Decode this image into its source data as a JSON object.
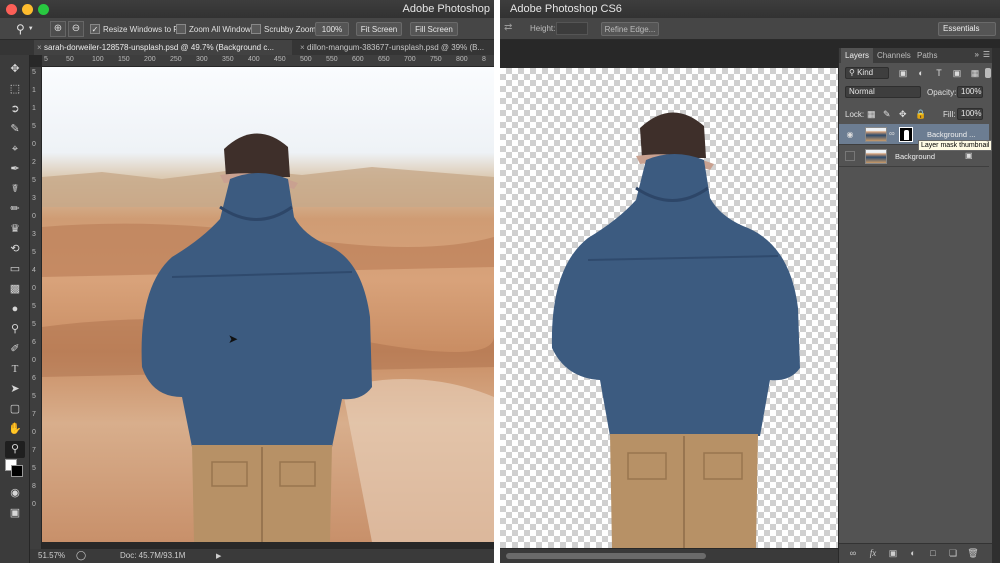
{
  "left": {
    "title": "Adobe Photoshop",
    "options": {
      "resize_windows": "Resize Windows to Fit",
      "zoom_all": "Zoom All Windows",
      "scrubby": "Scrubby Zoom",
      "zoom_value": "100%",
      "fit_screen": "Fit Screen",
      "fill_screen": "Fill Screen"
    },
    "tabs": [
      {
        "label": "sarah-dorweiler-128578-unsplash.psd @ 49.7% (Background c..."
      },
      {
        "label": "dillon-mangum-383677-unsplash.psd @ 39% (B..."
      }
    ],
    "ruler_top": [
      "5",
      "50",
      "100",
      "150",
      "200",
      "250",
      "300",
      "350",
      "400",
      "450",
      "500",
      "550",
      "600",
      "650",
      "700",
      "750",
      "800",
      "8"
    ],
    "ruler_left": [
      "5",
      "1",
      "1",
      "5",
      "0",
      "2",
      "5",
      "3",
      "0",
      "3",
      "5",
      "4",
      "0",
      "5",
      "5",
      "6",
      "0",
      "6",
      "5",
      "7",
      "0",
      "7",
      "5",
      "8",
      "0"
    ],
    "status": {
      "zoom": "51.57%",
      "doc": "Doc: 45.7M/93.1M"
    }
  },
  "right": {
    "title": "Adobe Photoshop CS6",
    "options": {
      "height_label": "Height:",
      "refine_edge": "Refine Edge...",
      "workspace": "Essentials"
    },
    "layers_panel": {
      "tabs": [
        "Layers",
        "Channels",
        "Paths"
      ],
      "kind": "Kind",
      "blend_mode": "Normal",
      "opacity_label": "Opacity:",
      "opacity_value": "100%",
      "lock_label": "Lock:",
      "fill_label": "Fill:",
      "fill_value": "100%",
      "layers": [
        {
          "name": "Background ..."
        },
        {
          "name": "Background"
        }
      ],
      "tooltip": "Layer mask thumbnail"
    }
  }
}
